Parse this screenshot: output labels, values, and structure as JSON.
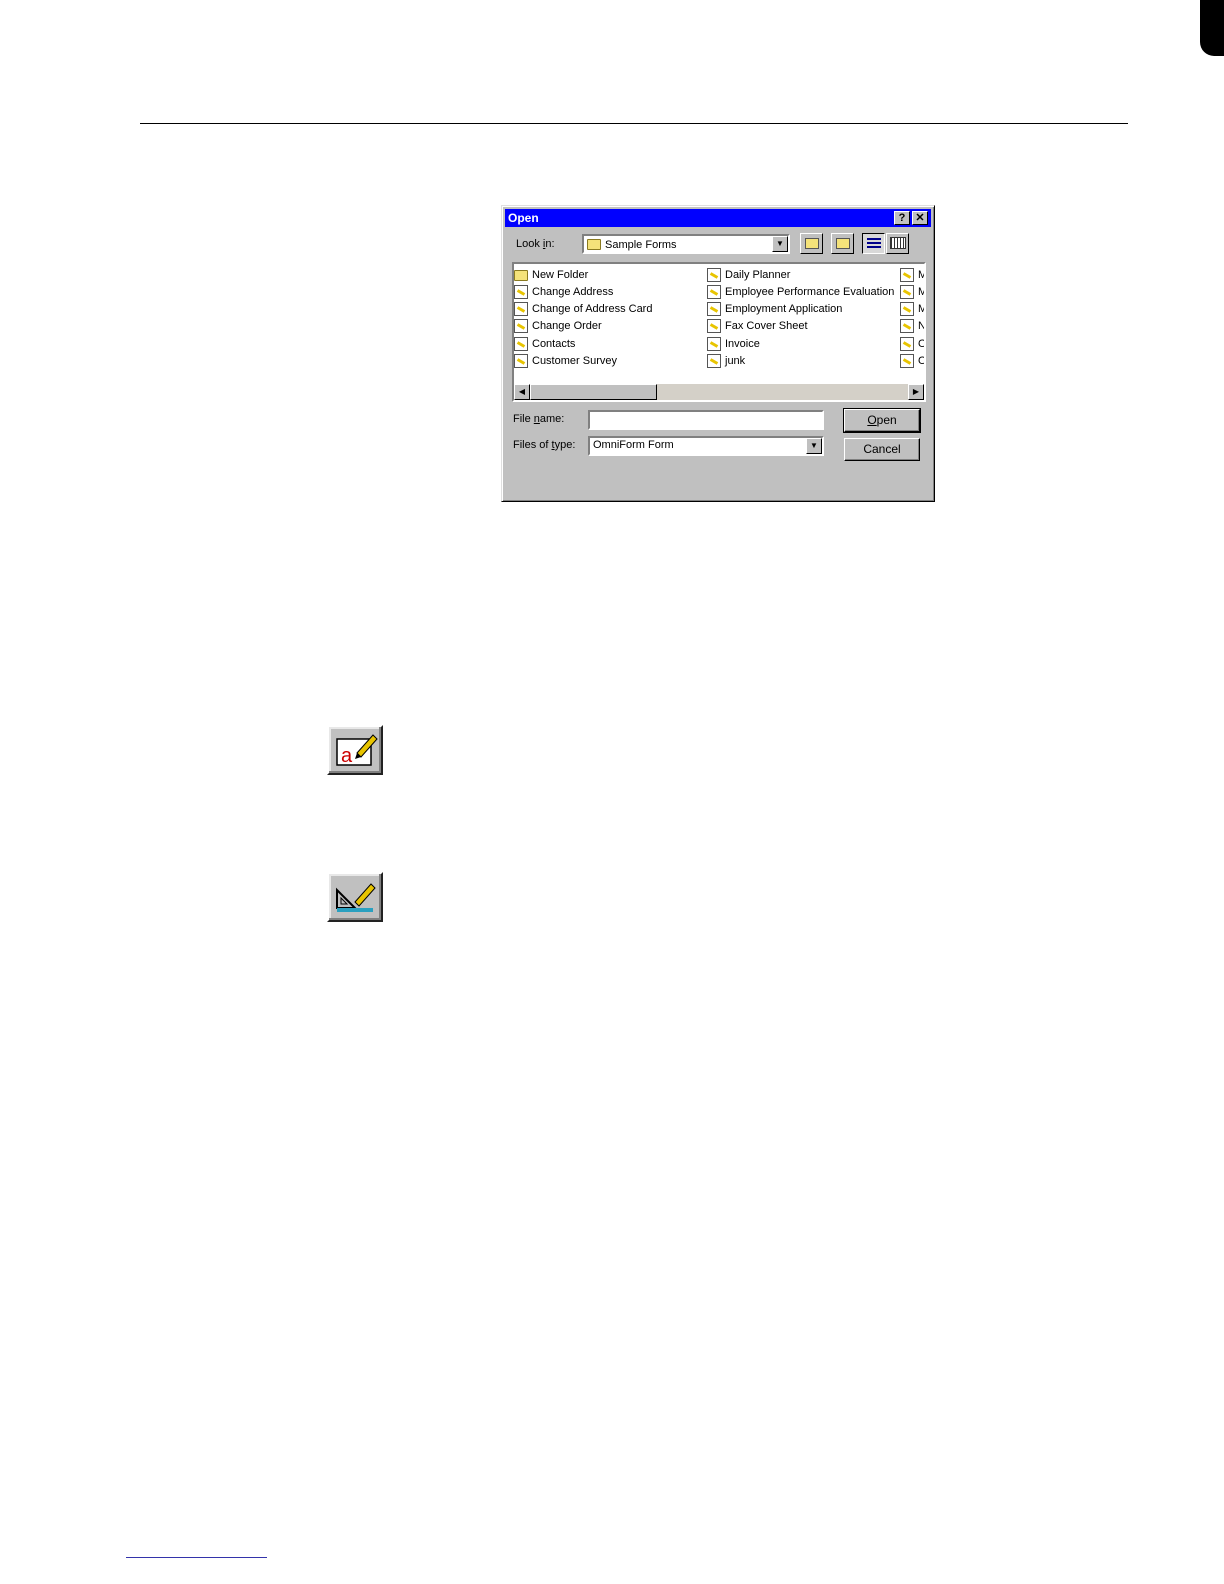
{
  "dialog": {
    "title": "Open",
    "help_btn": "?",
    "close_btn": "✕",
    "look_in_label_pre": "Look ",
    "look_in_label_u": "i",
    "look_in_label_post": "n:",
    "look_in_value": "Sample Forms",
    "columns": [
      [
        "New Folder",
        "Change Address",
        "Change of Address Card",
        "Change Order",
        "Contacts",
        "Customer Survey"
      ],
      [
        "Daily Planner",
        "Employee Performance Evaluation",
        "Employment Application",
        "Fax Cover Sheet",
        "Invoice",
        "junk"
      ],
      [
        "M",
        "M",
        "M",
        "N",
        "O",
        "O"
      ]
    ],
    "file_name_label_pre": "File ",
    "file_name_label_u": "n",
    "file_name_label_post": "ame:",
    "file_name_value": "",
    "files_of_type_label_pre": "Files of ",
    "files_of_type_label_u": "t",
    "files_of_type_label_post": "ype:",
    "files_of_type_value": "OmniForm Form",
    "open_btn_u": "O",
    "open_btn_rest": "pen",
    "cancel_btn": "Cancel",
    "scroll_left": "◀",
    "scroll_right": "▶",
    "dropdown_arrow": "▼"
  },
  "page_icons": [
    {
      "name": "fill-mode-icon",
      "glyph": "a"
    },
    {
      "name": "design-mode-icon"
    }
  ],
  "colors": {
    "titlebar": "#0000ff",
    "face": "#c0c0c0"
  }
}
